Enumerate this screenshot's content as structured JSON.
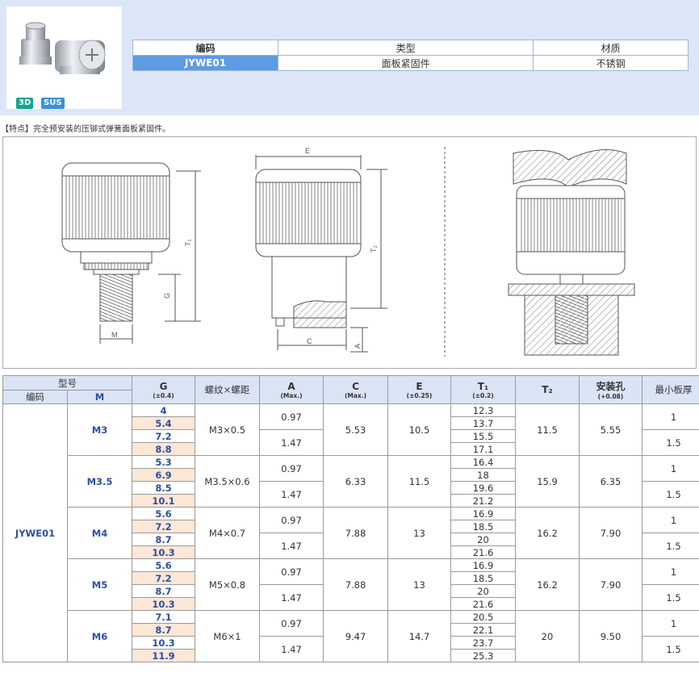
{
  "badges": {
    "b3d": "3D",
    "sus": "SUS"
  },
  "info_table": {
    "headers": [
      "编码",
      "类型",
      "材质"
    ],
    "values": [
      "JYWE01",
      "面板紧固件",
      "不锈钢"
    ]
  },
  "feature_text": "【特点】完全预安装的压铆式弹簧面板紧固件。",
  "diagram_labels": {
    "E": "E",
    "T1": "T₁",
    "T2": "T₂",
    "G": "G",
    "M": "M",
    "C": "C",
    "A": "A"
  },
  "spec_table": {
    "group_header": "型号",
    "sub_headers": [
      "编码",
      "M"
    ],
    "columns": [
      {
        "label": "G",
        "sub": "(±0.4)"
      },
      {
        "label": "螺纹×螺距",
        "sub": ""
      },
      {
        "label": "A",
        "sub": "(Max.)"
      },
      {
        "label": "C",
        "sub": "(Max.)"
      },
      {
        "label": "E",
        "sub": "(±0.25)"
      },
      {
        "label": "T₁",
        "sub": "(±0.2)"
      },
      {
        "label": "T₂",
        "sub": ""
      },
      {
        "label": "安装孔",
        "sub": "(+0.08)"
      },
      {
        "label": "最小板厚",
        "sub": ""
      }
    ],
    "code": "JYWE01",
    "groups": [
      {
        "m": "M3",
        "thread": "M3×0.5",
        "g": [
          "4",
          "5.4",
          "7.2",
          "8.8"
        ],
        "a": [
          "0.97",
          "1.47"
        ],
        "c": "5.53",
        "e": "10.5",
        "t1": [
          "12.3",
          "13.7",
          "15.5",
          "17.1"
        ],
        "t2": "11.5",
        "hole": "5.55",
        "min": [
          "1",
          "1.5"
        ]
      },
      {
        "m": "M3.5",
        "thread": "M3.5×0.6",
        "g": [
          "5.3",
          "6.9",
          "8.5",
          "10.1"
        ],
        "a": [
          "0.97",
          "1.47"
        ],
        "c": "6.33",
        "e": "11.5",
        "t1": [
          "16.4",
          "18",
          "19.6",
          "21.2"
        ],
        "t2": "15.9",
        "hole": "6.35",
        "min": [
          "1",
          "1.5"
        ]
      },
      {
        "m": "M4",
        "thread": "M4×0.7",
        "g": [
          "5.6",
          "7.2",
          "8.7",
          "10.3"
        ],
        "a": [
          "0.97",
          "1.47"
        ],
        "c": "7.88",
        "e": "13",
        "t1": [
          "16.9",
          "18.5",
          "20",
          "21.6"
        ],
        "t2": "16.2",
        "hole": "7.90",
        "min": [
          "1",
          "1.5"
        ]
      },
      {
        "m": "M5",
        "thread": "M5×0.8",
        "g": [
          "5.6",
          "7.2",
          "8.7",
          "10.3"
        ],
        "a": [
          "0.97",
          "1.47"
        ],
        "c": "7.88",
        "e": "13",
        "t1": [
          "16.9",
          "18.5",
          "20",
          "21.6"
        ],
        "t2": "16.2",
        "hole": "7.90",
        "min": [
          "1",
          "1.5"
        ]
      },
      {
        "m": "M6",
        "thread": "M6×1",
        "g": [
          "7.1",
          "8.7",
          "10.3",
          "11.9"
        ],
        "a": [
          "0.97",
          "1.47"
        ],
        "c": "9.47",
        "e": "14.7",
        "t1": [
          "20.5",
          "22.1",
          "23.7",
          "25.3"
        ],
        "t2": "20",
        "hole": "9.50",
        "min": [
          "1",
          "1.5"
        ]
      }
    ]
  }
}
